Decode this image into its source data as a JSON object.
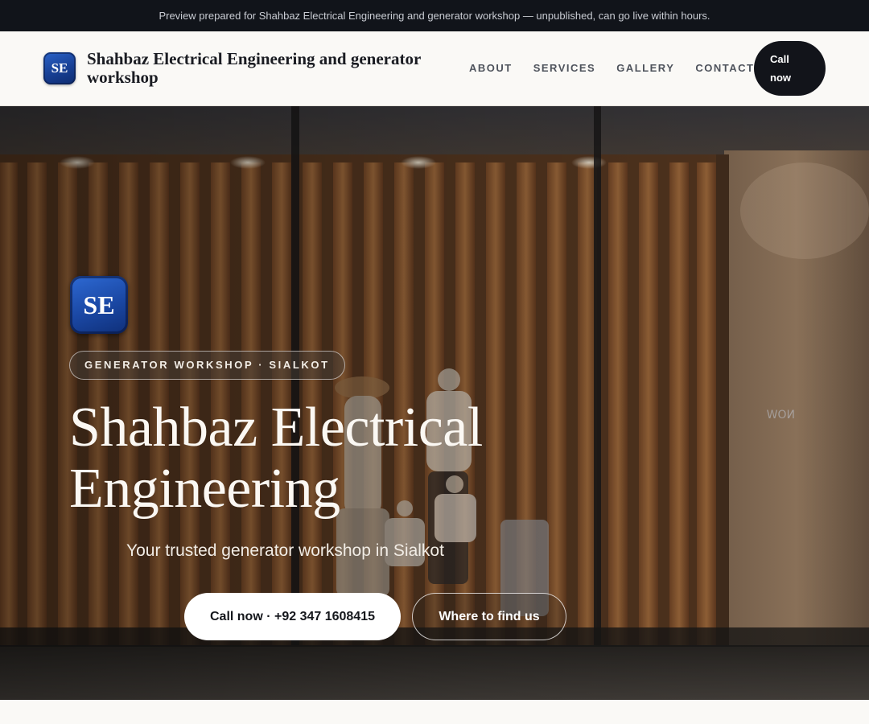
{
  "banner": {
    "text": "Preview prepared for Shahbaz Electrical Engineering and generator workshop — unpublished, can go live within hours."
  },
  "header": {
    "logo_initials": "SE",
    "brand_name": "Shahbaz Electrical Engineering and generator workshop",
    "nav": [
      {
        "label": "ABOUT"
      },
      {
        "label": "SERVICES"
      },
      {
        "label": "GALLERY"
      },
      {
        "label": "CONTACT"
      }
    ],
    "cta_line1": "Call",
    "cta_line2": "now"
  },
  "hero": {
    "logo_initials": "SE",
    "eyebrow": "GENERATOR WORKSHOP · SIALKOT",
    "title_line1": "Shahbaz Electrical",
    "title_line2": "Engineering",
    "subtitle": "Your trusted generator workshop in Sialkot",
    "primary_button": "Call now · +92 347 1608415",
    "secondary_button": "Where to find us"
  },
  "colors": {
    "banner_bg": "#11141a",
    "header_bg": "#faf9f6",
    "accent_dark": "#12141a",
    "logo_blue": "#1a47a3"
  }
}
